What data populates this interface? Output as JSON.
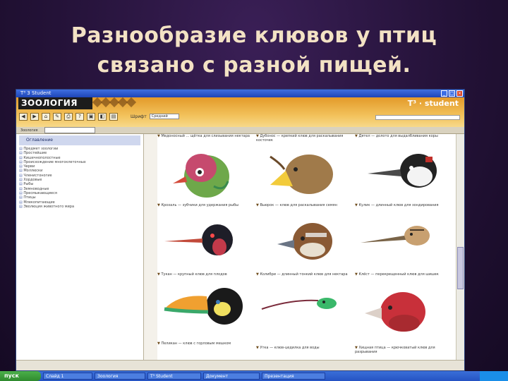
{
  "slide": {
    "title_line1": "Разнообразие клювов у птиц",
    "title_line2": "связано с разной пищей."
  },
  "window": {
    "title": "T³ 3   Student",
    "min_label": "_",
    "max_label": "□",
    "close_label": "×"
  },
  "app": {
    "logo": "ЗООЛОГИЯ",
    "brand": "T³ · student",
    "font_label": "Шрифт",
    "font_value": "Средний",
    "subbar_label": "Зоология",
    "subbar_select": "Оглавление"
  },
  "toolbar": {
    "buttons": [
      "◀",
      "▶",
      "⌂",
      "✎",
      "⎙",
      "?",
      "▣",
      "◧",
      "▤"
    ]
  },
  "sidebar": {
    "header": "Оглавление",
    "items": [
      "Предмет зоологии",
      "Простейшие",
      "Кишечнополостные",
      "Происхождение многоклеточных",
      "Черви",
      "Моллюски",
      "Членистоногие",
      "Хордовые",
      "Рыбы",
      "Земноводные",
      "Пресмыкающиеся",
      "Птицы",
      "Млекопитающие",
      "Эволюция животного мира"
    ]
  },
  "content": {
    "captions": [
      "Медоносный ... щётка для слизывания нектара",
      "Дубонос — крепкий клюв для раскалывания косточек",
      "Дятел — долото для выдалбливания коры",
      "Крохаль — зубчики для удержания рыбы",
      "Вьюрок — клюв для раскалывания семян",
      "Кулик — длинный клюв для зондирования",
      "Тукан — крупный клюв для плодов",
      "Колибри — длинный тонкий клюв для нектара",
      "Клёст — перекрещенный клюв для шишек",
      "Пеликан — клюв с горловым мешком",
      "Утка — клюв-цедилка для воды",
      "Хищная птица — крючковатый клюв для разрывания"
    ]
  },
  "taskbar": {
    "start": "пуск",
    "items": [
      "Слайд 1",
      "Зоология",
      "T³ Student",
      "Документ",
      "Презентация"
    ]
  },
  "colors": {
    "slide_bg": "#241238",
    "title": "#f3e2c4",
    "app_header": "#e39a2a",
    "xp_blue": "#2553c3"
  }
}
